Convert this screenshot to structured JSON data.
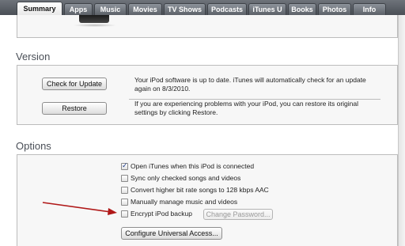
{
  "tabs": [
    {
      "label": "Summary",
      "active": true
    },
    {
      "label": "Apps"
    },
    {
      "label": "Music"
    },
    {
      "label": "Movies"
    },
    {
      "label": "TV Shows"
    },
    {
      "label": "Podcasts"
    },
    {
      "label": "iTunes U"
    },
    {
      "label": "Books"
    },
    {
      "label": "Photos"
    },
    {
      "label": "Info"
    }
  ],
  "version": {
    "title": "Version",
    "check_button": "Check for Update",
    "restore_button": "Restore",
    "update_status_line1": "Your iPod software is up to date. iTunes will automatically check for an update",
    "update_status_line2": "again on 8/3/2010.",
    "restore_info_line1": "If you are experiencing problems with your iPod, you can restore its original",
    "restore_info_line2": "settings by clicking Restore."
  },
  "options": {
    "title": "Options",
    "items": [
      {
        "label": "Open iTunes when this iPod is connected",
        "checked": true
      },
      {
        "label": "Sync only checked songs and videos",
        "checked": false
      },
      {
        "label": "Convert higher bit rate songs to 128 kbps AAC",
        "checked": false
      },
      {
        "label": "Manually manage music and videos",
        "checked": false
      },
      {
        "label": "Encrypt iPod backup",
        "checked": false
      }
    ],
    "change_password_button": "Change Password...",
    "configure_access_button": "Configure Universal Access..."
  },
  "colors": {
    "annotation_arrow": "#b01818",
    "tab_bar": "#5a5f66",
    "section_title": "#4a4f57"
  }
}
